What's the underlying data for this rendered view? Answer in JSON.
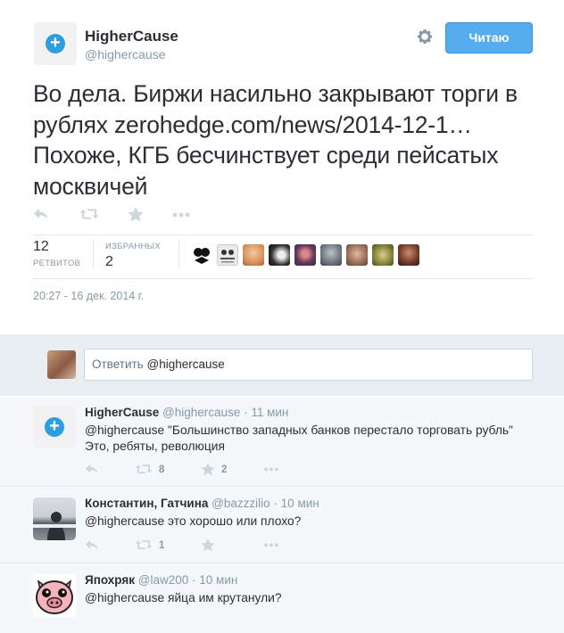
{
  "author": {
    "name": "HigherCause",
    "handle": "@highercause",
    "avatar_icon": "plus-circle-icon"
  },
  "follow_button": {
    "label": "Читаю",
    "color": "#55acee"
  },
  "tweet": {
    "text": "Во дела. Биржи насильно закрывают торги в рублях zerohedge.com/news/2014-12-1… Похоже, КГБ бесчинствует среди пейсатых москвичей",
    "retweets": {
      "count": "12",
      "label": "РЕТВИТОВ"
    },
    "favorites": {
      "count": "2",
      "label": "ИЗБРАННЫХ"
    },
    "timestamp": "20:27 - 16 дек. 2014 г."
  },
  "reply_box": {
    "placeholder_prefix": "Ответить",
    "mention": "@highercause"
  },
  "replies": [
    {
      "name": "HigherCause",
      "handle": "@highercause",
      "time": "11 мин",
      "text_line1": "@highercause \"Большинство западных банков перестало торговать рубль\"",
      "text_line2": "Это, ребяты, революция",
      "retweet_count": "8",
      "favorite_count": "2"
    },
    {
      "name": "Константин, Гатчина",
      "handle": "@bazzzilio",
      "time": "10 мин",
      "text_line1": "@highercause это хорошо или плохо?",
      "retweet_count": "1"
    },
    {
      "name": "Япохряк",
      "handle": "@law200",
      "time": "10 мин",
      "text_line1": "@highercause яйца им крутанули?"
    }
  ],
  "separator": "·",
  "colors": {
    "accent": "#55acee",
    "muted": "#8899a6",
    "icon": "#ccd6dd",
    "text": "#292f33"
  }
}
